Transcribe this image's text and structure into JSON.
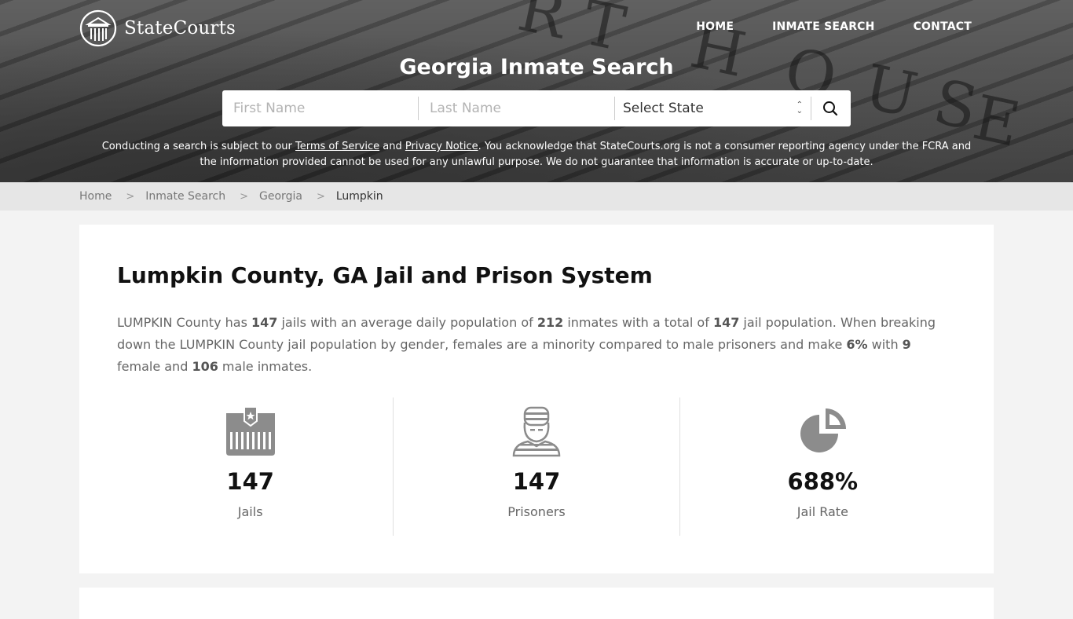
{
  "header": {
    "logo_text": "StateCourts",
    "nav": [
      {
        "label": "HOME"
      },
      {
        "label": "INMATE SEARCH"
      },
      {
        "label": "CONTACT"
      }
    ]
  },
  "hero": {
    "title": "Georgia Inmate Search",
    "search": {
      "first_name_placeholder": "First Name",
      "last_name_placeholder": "Last Name",
      "state_select_value": "Select State",
      "search_icon": "search-icon"
    },
    "disclaimer": {
      "prefix": "Conducting a search is subject to our ",
      "terms_link": "Terms of Service",
      "and": " and ",
      "privacy_link": "Privacy Notice",
      "suffix": ". You acknowledge that StateCourts.org is not a consumer reporting agency under the FCRA and the information provided cannot be used for any unlawful purpose. We do not guarantee that information is accurate or up-to-date."
    }
  },
  "breadcrumb": {
    "items": [
      {
        "label": "Home"
      },
      {
        "label": "Inmate Search"
      },
      {
        "label": "Georgia"
      },
      {
        "label": "Lumpkin"
      }
    ]
  },
  "main": {
    "title": "Lumpkin County, GA Jail and Prison System",
    "summary": {
      "t1": "LUMPKIN County has ",
      "jails": "147",
      "t2": " jails with an average daily population of ",
      "avg_pop": "212",
      "t3": " inmates with a total of ",
      "total": "147",
      "t4": " jail population. When breaking down the LUMPKIN County jail population by gender, females are a minority compared to male prisoners and make ",
      "female_pct": "6%",
      "t5": " with ",
      "female": "9",
      "t6": " female and ",
      "male": "106",
      "t7": " male inmates."
    },
    "stats": [
      {
        "icon": "jail-icon",
        "value": "147",
        "label": "Jails"
      },
      {
        "icon": "prisoner-icon",
        "value": "147",
        "label": "Prisoners"
      },
      {
        "icon": "pie-chart-icon",
        "value": "688%",
        "label": "Jail Rate"
      }
    ]
  }
}
